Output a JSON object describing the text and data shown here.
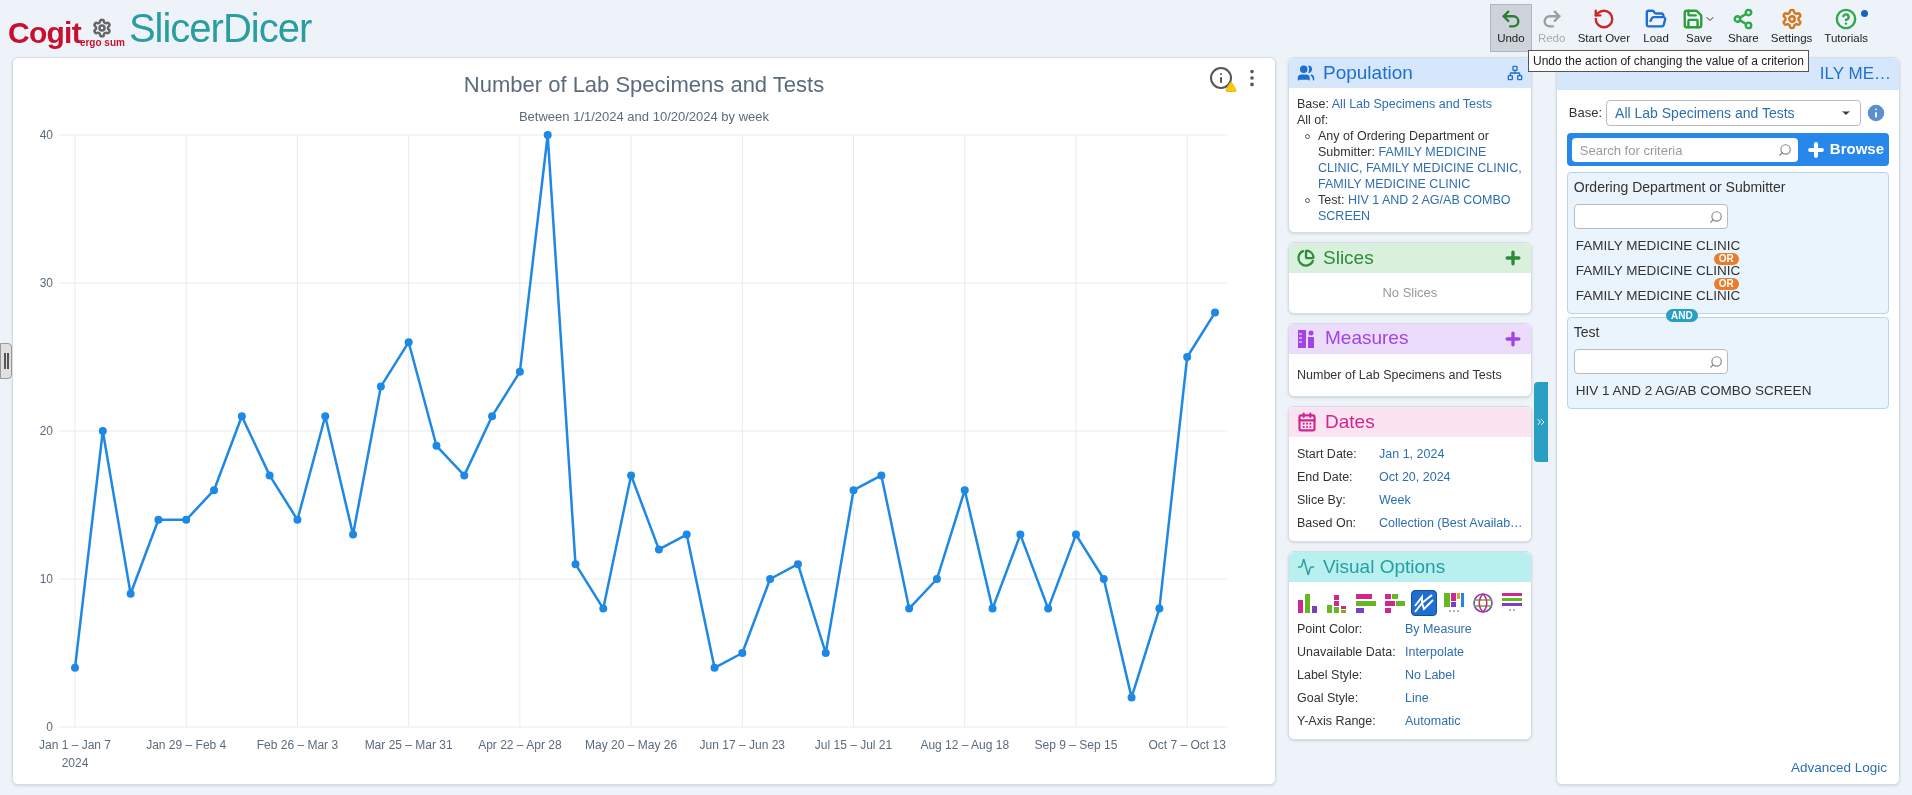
{
  "header": {
    "logo": {
      "brand": "Cogit",
      "tagline": "ergo sum",
      "product": "SlicerDicer"
    },
    "toolbar": [
      {
        "kind": "undo",
        "label": "Undo",
        "selected": true,
        "disabled": false
      },
      {
        "kind": "redo",
        "label": "Redo",
        "selected": false,
        "disabled": true
      },
      {
        "kind": "start_over",
        "label": "Start Over",
        "selected": false,
        "disabled": false
      },
      {
        "kind": "load",
        "label": "Load",
        "selected": false,
        "disabled": false
      },
      {
        "kind": "save",
        "label": "Save",
        "selected": false,
        "disabled": false
      },
      {
        "kind": "share",
        "label": "Share",
        "selected": false,
        "disabled": false
      },
      {
        "kind": "settings",
        "label": "Settings",
        "selected": false,
        "disabled": false
      },
      {
        "kind": "tutorials",
        "label": "Tutorials",
        "selected": false,
        "disabled": false,
        "badge": true
      }
    ]
  },
  "tooltip": "Undo the action of changing the value of a criterion",
  "chart_panel": {
    "title": "Number of Lab Specimens and Tests",
    "subtitle": "Between 1/1/2024 and 10/20/2024 by week",
    "year_label": "2024",
    "chart_data": {
      "type": "line",
      "categories": [
        "Jan 1 – Jan 7",
        null,
        null,
        null,
        "Jan 29 – Feb 4",
        null,
        null,
        null,
        "Feb 26 – Mar 3",
        null,
        null,
        null,
        "Mar 25 – Mar 31",
        null,
        null,
        null,
        "Apr 22 – Apr 28",
        null,
        null,
        null,
        "May 20 – May 26",
        null,
        null,
        null,
        "Jun 17 – Jun 23",
        null,
        null,
        null,
        "Jul 15 – Jul 21",
        null,
        null,
        null,
        "Aug 12 – Aug 18",
        null,
        null,
        null,
        "Sep 9 – Sep 15",
        null,
        null,
        null,
        "Oct 7 – Oct 13",
        null
      ],
      "series": [
        {
          "color": "#1e88e5",
          "values": [
            4,
            20,
            9,
            14,
            14,
            16,
            21,
            17,
            14,
            21,
            13,
            23,
            26,
            19,
            17,
            21,
            24,
            40,
            11,
            8,
            17,
            12,
            13,
            4,
            5,
            10,
            11,
            5,
            16,
            17,
            8,
            10,
            16,
            8,
            13,
            8,
            13,
            10,
            2,
            8,
            25,
            28
          ]
        }
      ],
      "ylim": [
        0,
        40
      ],
      "yticks": [
        0,
        10,
        20,
        30,
        40
      ],
      "grid": true,
      "marker": true
    }
  },
  "population": {
    "title": "Population",
    "base_label": "Base:",
    "base_value": "All Lab Specimens and Tests",
    "all_of": "All of:",
    "criteria": [
      {
        "label": "Any of Ordering Department or Submitter:",
        "value": "FAMILY MEDICINE CLINIC, FAMILY MEDICINE CLINIC, FAMILY MEDICINE CLINIC"
      },
      {
        "label": "Test:",
        "value": "HIV 1 AND 2 AG/AB COMBO SCREEN"
      }
    ]
  },
  "slices": {
    "title": "Slices",
    "empty": "No Slices"
  },
  "measures": {
    "title": "Measures",
    "items": [
      "Number of Lab Specimens and Tests"
    ]
  },
  "dates": {
    "title": "Dates",
    "rows": [
      {
        "label": "Start Date:",
        "value": "Jan 1, 2024"
      },
      {
        "label": "End Date:",
        "value": "Oct 20, 2024"
      },
      {
        "label": "Slice By:",
        "value": "Week"
      },
      {
        "label": "Based On:",
        "value": "Collection (Best Availab…"
      }
    ]
  },
  "visual_options": {
    "title": "Visual Options",
    "chart_types": [
      {
        "kind": "column",
        "selected": false
      },
      {
        "kind": "stacked_column",
        "selected": false
      },
      {
        "kind": "bar",
        "selected": false
      },
      {
        "kind": "stacked_bar",
        "selected": false
      },
      {
        "kind": "line",
        "selected": true
      },
      {
        "kind": "heatmap",
        "selected": false
      },
      {
        "kind": "map",
        "selected": false
      },
      {
        "kind": "list",
        "selected": false
      }
    ],
    "rows": [
      {
        "label": "Point Color:",
        "value": "By Measure"
      },
      {
        "label": "Unavailable Data:",
        "value": "Interpolate"
      },
      {
        "label": "Label Style:",
        "value": "No Label"
      },
      {
        "label": "Goal Style:",
        "value": "Line"
      },
      {
        "label": "Y-Axis Range:",
        "value": "Automatic"
      }
    ]
  },
  "criteria_panel": {
    "title": "ILY ME…",
    "base_label": "Base:",
    "base_value": "All Lab Specimens and Tests",
    "search_placeholder": "Search for criteria",
    "browse": "Browse",
    "group_joiner": "AND",
    "groups": [
      {
        "title": "Ordering Department or Submitter",
        "values": [
          {
            "text": "FAMILY MEDICINE CLINIC",
            "joiner": "OR"
          },
          {
            "text": "FAMILY MEDICINE CLINIC",
            "joiner": "OR"
          },
          {
            "text": "FAMILY MEDICINE CLINIC"
          }
        ]
      },
      {
        "title": "Test",
        "values": [
          {
            "text": "HIV 1 AND 2 AG/AB COMBO SCREEN"
          }
        ]
      }
    ],
    "advanced": "Advanced Logic"
  }
}
